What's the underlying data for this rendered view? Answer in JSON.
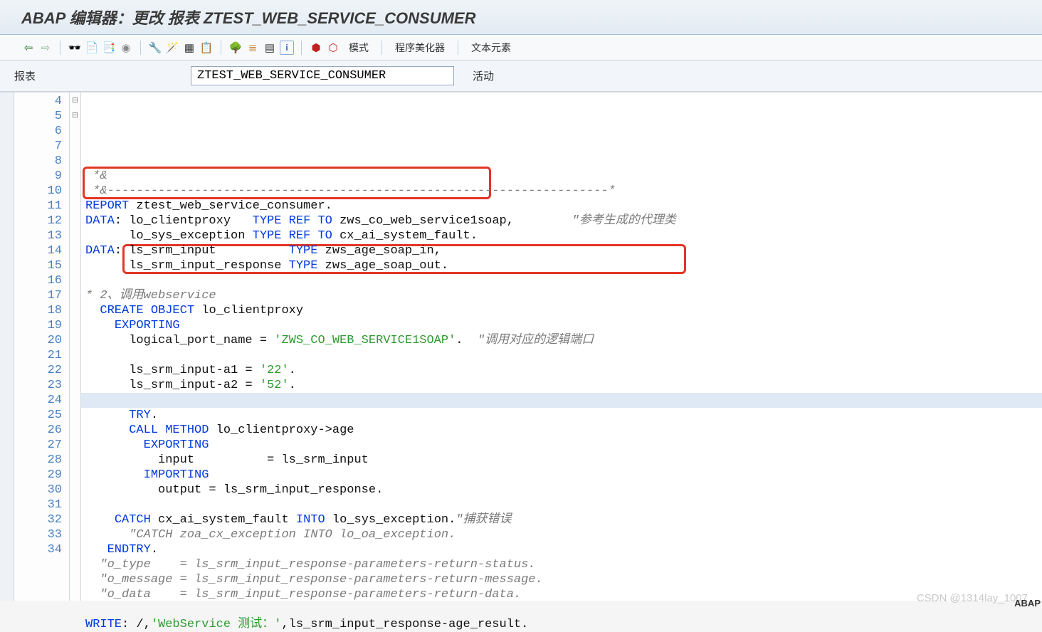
{
  "title": "ABAP 编辑器：更改 报表 ZTEST_WEB_SERVICE_CONSUMER",
  "toolbar": {
    "mode_label": "模式",
    "beautifier_label": "程序美化器",
    "text_elements_label": "文本元素"
  },
  "program_row": {
    "label": "报表",
    "value": "ZTEST_WEB_SERVICE_CONSUMER",
    "status": "活动"
  },
  "editor": {
    "first_line_no": 4,
    "current_line": 19,
    "lines": [
      {
        "no": 4,
        "fold": "",
        "raw": " *&"
      },
      {
        "no": 5,
        "fold": "",
        "raw": " *&---------------------------------------------------------------------*"
      },
      {
        "no": 6,
        "fold": "",
        "raw": "REPORT ztest_web_service_consumer."
      },
      {
        "no": 7,
        "fold": "",
        "raw": "DATA: lo_clientproxy   TYPE REF TO zws_co_web_service1soap,        \"参考生成的代理类"
      },
      {
        "no": 8,
        "fold": "",
        "raw": "      lo_sys_exception TYPE REF TO cx_ai_system_fault."
      },
      {
        "no": 9,
        "fold": "",
        "raw": "DATA: ls_srm_input          TYPE zws_age_soap_in,"
      },
      {
        "no": 10,
        "fold": "",
        "raw": "      ls_srm_input_response TYPE zws_age_soap_out."
      },
      {
        "no": 11,
        "fold": "",
        "raw": ""
      },
      {
        "no": 12,
        "fold": "",
        "raw": "* 2、调用webservice"
      },
      {
        "no": 13,
        "fold": "",
        "raw": "  CREATE OBJECT lo_clientproxy"
      },
      {
        "no": 14,
        "fold": "",
        "raw": "    EXPORTING"
      },
      {
        "no": 15,
        "fold": "",
        "raw": "      logical_port_name = 'ZWS_CO_WEB_SERVICE1SOAP'.  \"调用对应的逻辑端口"
      },
      {
        "no": 16,
        "fold": "",
        "raw": ""
      },
      {
        "no": 17,
        "fold": "",
        "raw": "      ls_srm_input-a1 = '22'."
      },
      {
        "no": 18,
        "fold": "",
        "raw": "      ls_srm_input-a2 = '52'."
      },
      {
        "no": 19,
        "fold": "",
        "raw": ""
      },
      {
        "no": 20,
        "fold": "⊟",
        "raw": "      TRY."
      },
      {
        "no": 21,
        "fold": "",
        "raw": "      CALL METHOD lo_clientproxy->age"
      },
      {
        "no": 22,
        "fold": "",
        "raw": "        EXPORTING"
      },
      {
        "no": 23,
        "fold": "",
        "raw": "          input          = ls_srm_input"
      },
      {
        "no": 24,
        "fold": "",
        "raw": "        IMPORTING"
      },
      {
        "no": 25,
        "fold": "",
        "raw": "          output = ls_srm_input_response."
      },
      {
        "no": 26,
        "fold": "",
        "raw": ""
      },
      {
        "no": 27,
        "fold": "",
        "raw": "    CATCH cx_ai_system_fault INTO lo_sys_exception.\"捕获错误"
      },
      {
        "no": 28,
        "fold": "",
        "raw": "      \"CATCH zoa_cx_exception INTO lo_oa_exception."
      },
      {
        "no": 29,
        "fold": "",
        "raw": "   ENDTRY."
      },
      {
        "no": 30,
        "fold": "⊟",
        "raw": "  \"o_type    = ls_srm_input_response-parameters-return-status."
      },
      {
        "no": 31,
        "fold": "",
        "raw": "  \"o_message = ls_srm_input_response-parameters-return-message."
      },
      {
        "no": 32,
        "fold": "",
        "raw": "  \"o_data    = ls_srm_input_response-parameters-return-data."
      },
      {
        "no": 33,
        "fold": "",
        "raw": ""
      },
      {
        "no": 34,
        "fold": "",
        "raw": "WRITE: /,'WebService 测试：',ls_srm_input_response-age_result."
      }
    ]
  },
  "watermark": "CSDN @1314lay_1007",
  "lang_indicator": "ABAP"
}
